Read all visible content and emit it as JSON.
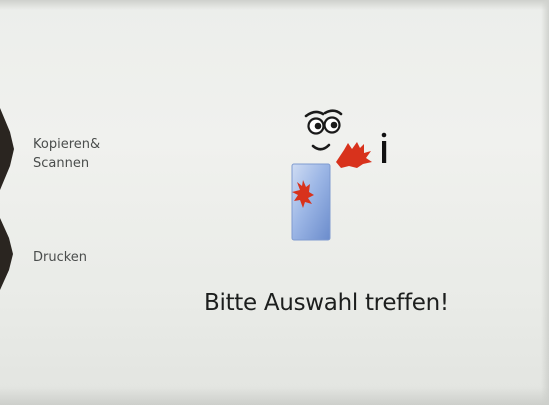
{
  "menu": {
    "items": [
      {
        "label": "Kopieren&\nScannen"
      },
      {
        "label": "Drucken"
      }
    ]
  },
  "main": {
    "prompt": "Bitte Auswahl treffen!",
    "mascot_icon": "info-mascot-icon"
  },
  "colors": {
    "background": "#eceeeb",
    "tab_marker": "#2a2520",
    "menu_text": "#4a4d4c",
    "prompt_text": "#1c1e1d",
    "mascot_hand": "#d8321c",
    "mascot_body": "#7ea0d8"
  }
}
